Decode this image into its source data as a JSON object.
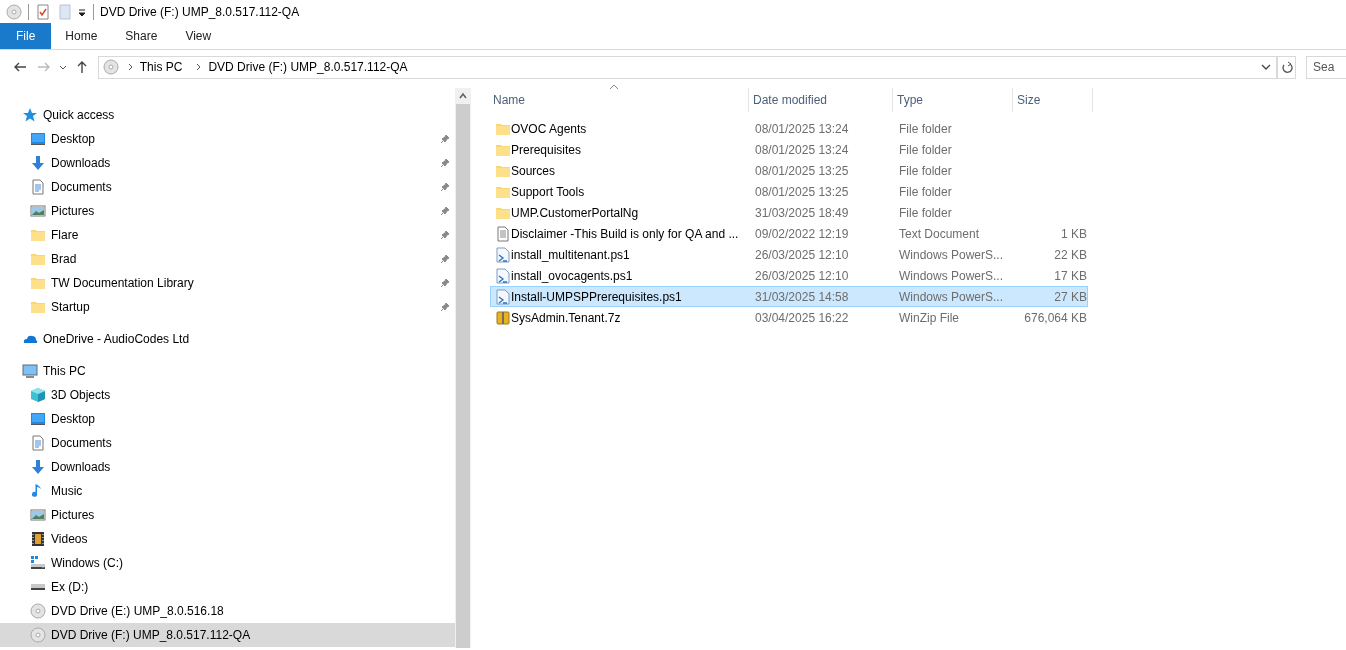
{
  "window": {
    "title": "DVD Drive (F:) UMP_8.0.517.112-QA"
  },
  "ribbon_tabs": [
    {
      "label": "File",
      "selected": true
    },
    {
      "label": "Home",
      "selected": false
    },
    {
      "label": "Share",
      "selected": false
    },
    {
      "label": "View",
      "selected": false
    }
  ],
  "address_bar": {
    "crumbs": [
      "This PC",
      "DVD Drive (F:) UMP_8.0.517.112-QA"
    ]
  },
  "search": {
    "placeholder": "Sea"
  },
  "sidebar": {
    "items": [
      {
        "label": "Quick access",
        "kind": "quick",
        "selected": false,
        "children": [
          {
            "label": "Desktop",
            "kind": "desktop",
            "pinned": true,
            "selected": false
          },
          {
            "label": "Downloads",
            "kind": "downloads",
            "pinned": true,
            "selected": false
          },
          {
            "label": "Documents",
            "kind": "documents",
            "pinned": true,
            "selected": false
          },
          {
            "label": "Pictures",
            "kind": "pictures",
            "pinned": true,
            "selected": false
          },
          {
            "label": "Flare",
            "kind": "folder",
            "pinned": true,
            "selected": false
          },
          {
            "label": "Brad",
            "kind": "folder",
            "pinned": true,
            "selected": false
          },
          {
            "label": "TW Documentation Library",
            "kind": "folder",
            "pinned": true,
            "selected": false
          },
          {
            "label": "Startup",
            "kind": "folder",
            "pinned": true,
            "selected": false
          }
        ]
      },
      {
        "label": "OneDrive - AudioCodes Ltd",
        "kind": "cloud",
        "selected": false
      },
      {
        "label": "This PC",
        "kind": "pc",
        "selected": false,
        "children": [
          {
            "label": "3D Objects",
            "kind": "objects3d",
            "selected": false
          },
          {
            "label": "Desktop",
            "kind": "desktop",
            "selected": false
          },
          {
            "label": "Documents",
            "kind": "documents",
            "selected": false
          },
          {
            "label": "Downloads",
            "kind": "downloads",
            "selected": false
          },
          {
            "label": "Music",
            "kind": "music",
            "selected": false
          },
          {
            "label": "Pictures",
            "kind": "pictures",
            "selected": false
          },
          {
            "label": "Videos",
            "kind": "videos",
            "selected": false
          },
          {
            "label": "Windows (C:)",
            "kind": "windrive",
            "selected": false
          },
          {
            "label": "Ex (D:)",
            "kind": "drive",
            "selected": false
          },
          {
            "label": "DVD Drive (E:) UMP_8.0.516.18",
            "kind": "dvd",
            "selected": false
          },
          {
            "label": "DVD Drive (F:) UMP_8.0.517.112-QA",
            "kind": "dvd",
            "selected": true
          }
        ]
      }
    ]
  },
  "file_list": {
    "columns": [
      "Name",
      "Date modified",
      "Type",
      "Size"
    ],
    "rows": [
      {
        "name": "OVOC Agents",
        "date_modified": "08/01/2025 13:24",
        "type": "File folder",
        "kind": "folder",
        "selected": false
      },
      {
        "name": "Prerequisites",
        "date_modified": "08/01/2025 13:24",
        "type": "File folder",
        "kind": "folder",
        "selected": false
      },
      {
        "name": "Sources",
        "date_modified": "08/01/2025 13:25",
        "type": "File folder",
        "kind": "folder",
        "selected": false
      },
      {
        "name": "Support Tools",
        "date_modified": "08/01/2025 13:25",
        "type": "File folder",
        "kind": "folder",
        "selected": false
      },
      {
        "name": "UMP.CustomerPortalNg",
        "date_modified": "31/03/2025 18:49",
        "type": "File folder",
        "kind": "folder",
        "selected": false
      },
      {
        "name": "Disclaimer -This Build is only for QA and ...",
        "date_modified": "09/02/2022 12:19",
        "type": "Text Document",
        "size": "1 KB",
        "kind": "text",
        "selected": false
      },
      {
        "name": "install_multitenant.ps1",
        "date_modified": "26/03/2025 12:10",
        "type": "Windows PowerS...",
        "size": "22 KB",
        "kind": "script",
        "selected": false
      },
      {
        "name": "install_ovocagents.ps1",
        "date_modified": "26/03/2025 12:10",
        "type": "Windows PowerS...",
        "size": "17 KB",
        "kind": "script",
        "selected": false
      },
      {
        "name": "Install-UMPSPPrerequisites.ps1",
        "date_modified": "31/03/2025 14:58",
        "type": "Windows PowerS...",
        "size": "27 KB",
        "kind": "script",
        "selected": true
      },
      {
        "name": "SysAdmin.Tenant.7z",
        "date_modified": "03/04/2025 16:22",
        "type": "WinZip File",
        "size": "676,064 KB",
        "kind": "archive",
        "selected": false
      }
    ]
  }
}
